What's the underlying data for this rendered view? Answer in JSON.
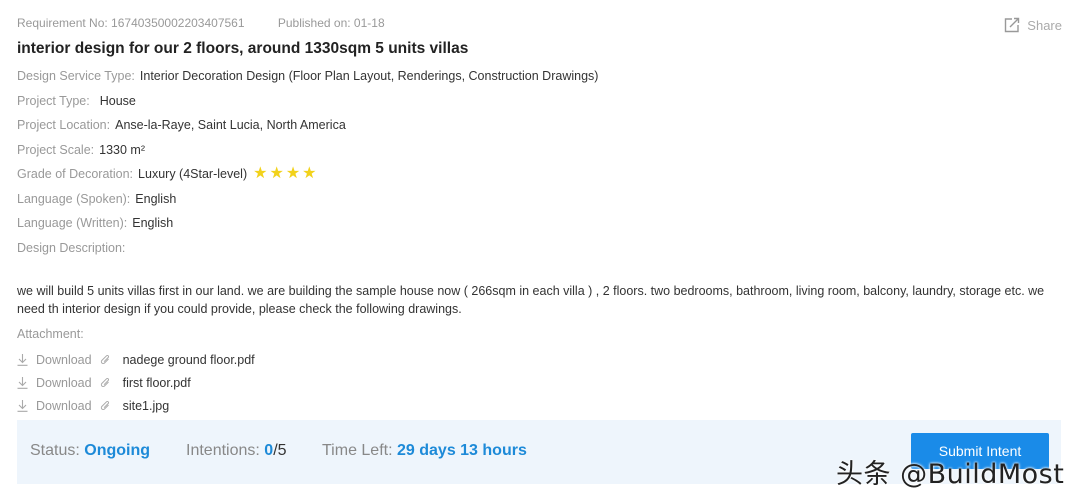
{
  "meta": {
    "requirement_no": "Requirement No: 16740350002203407561",
    "published": "Published on: 01-18",
    "share_label": "Share"
  },
  "title": "interior design for our 2 floors, around 1330sqm 5 units villas",
  "details": [
    {
      "label": "Design Service Type:",
      "value": "Interior Decoration Design (Floor Plan Layout, Renderings, Construction Drawings)"
    },
    {
      "label": "Project Type:",
      "value": "House"
    },
    {
      "label": "Project Location:",
      "value": "Anse-la-Raye, Saint Lucia, North America"
    },
    {
      "label": "Project Scale:",
      "value": "1330 m²"
    },
    {
      "label": "Grade of Decoration:",
      "value": "Luxury (4Star-level)",
      "stars": 4
    },
    {
      "label": "Language (Spoken):",
      "value": "English"
    },
    {
      "label": "Language (Written):",
      "value": "English"
    },
    {
      "label": "Design Description:",
      "value": ""
    }
  ],
  "description": "we will build 5 units villas first in our land. we are building the sample house now ( 266sqm in each villa ) , 2 floors. two bedrooms, bathroom, living room, balcony, laundry, storage etc. we need th interior design if you could provide, please check the following drawings.",
  "attachment_label": "Attachment:",
  "attachments": [
    {
      "download": "Download",
      "file": "nadege ground floor.pdf"
    },
    {
      "download": "Download",
      "file": "first floor.pdf"
    },
    {
      "download": "Download",
      "file": "site1.jpg"
    }
  ],
  "status": {
    "status_label": "Status:",
    "status_value": "Ongoing",
    "intentions_label": "Intentions:",
    "intentions_current": "0",
    "intentions_total": "/5",
    "time_label": "Time Left:",
    "time_value": "29 days 13 hours",
    "submit_label": "Submit Intent"
  },
  "watermark": "头条 @BuildMost",
  "colors": {
    "accent": "#1a8be8",
    "star": "#f2d21b",
    "status_bg": "#eef5fc"
  }
}
